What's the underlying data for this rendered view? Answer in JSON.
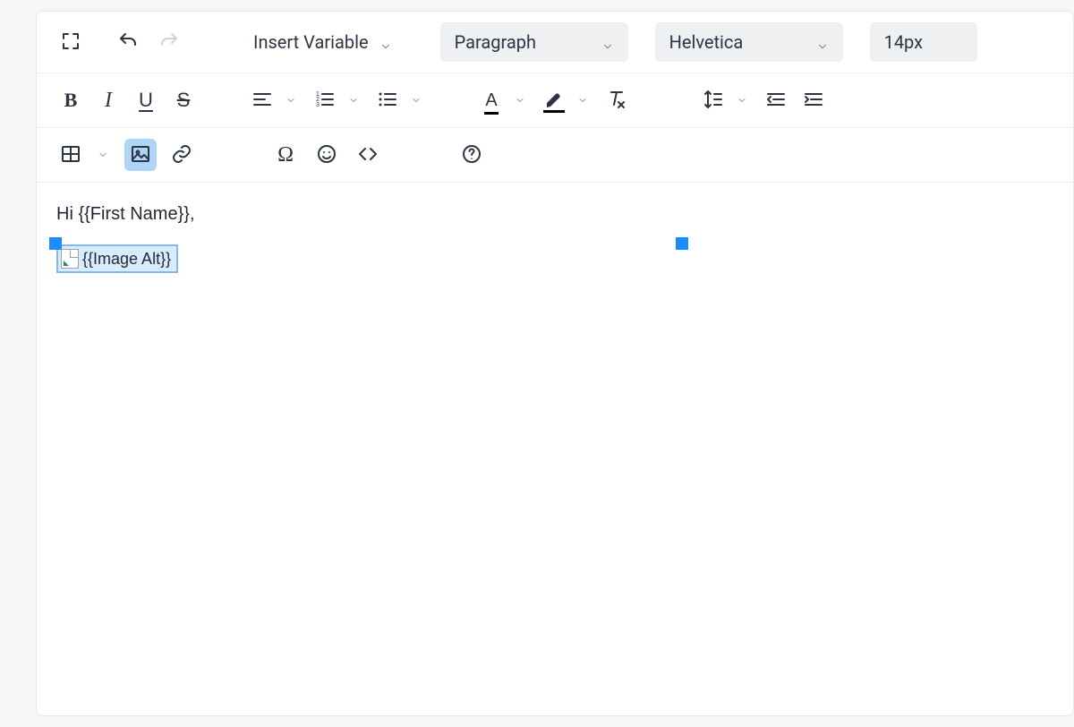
{
  "toolbar": {
    "insert_variable_label": "Insert Variable",
    "paragraph_label": "Paragraph",
    "font_family_label": "Helvetica",
    "font_size_label": "14px"
  },
  "content": {
    "line1": "Hi {{First Name}},",
    "image_placeholder_alt": "{{Image Alt}}"
  }
}
